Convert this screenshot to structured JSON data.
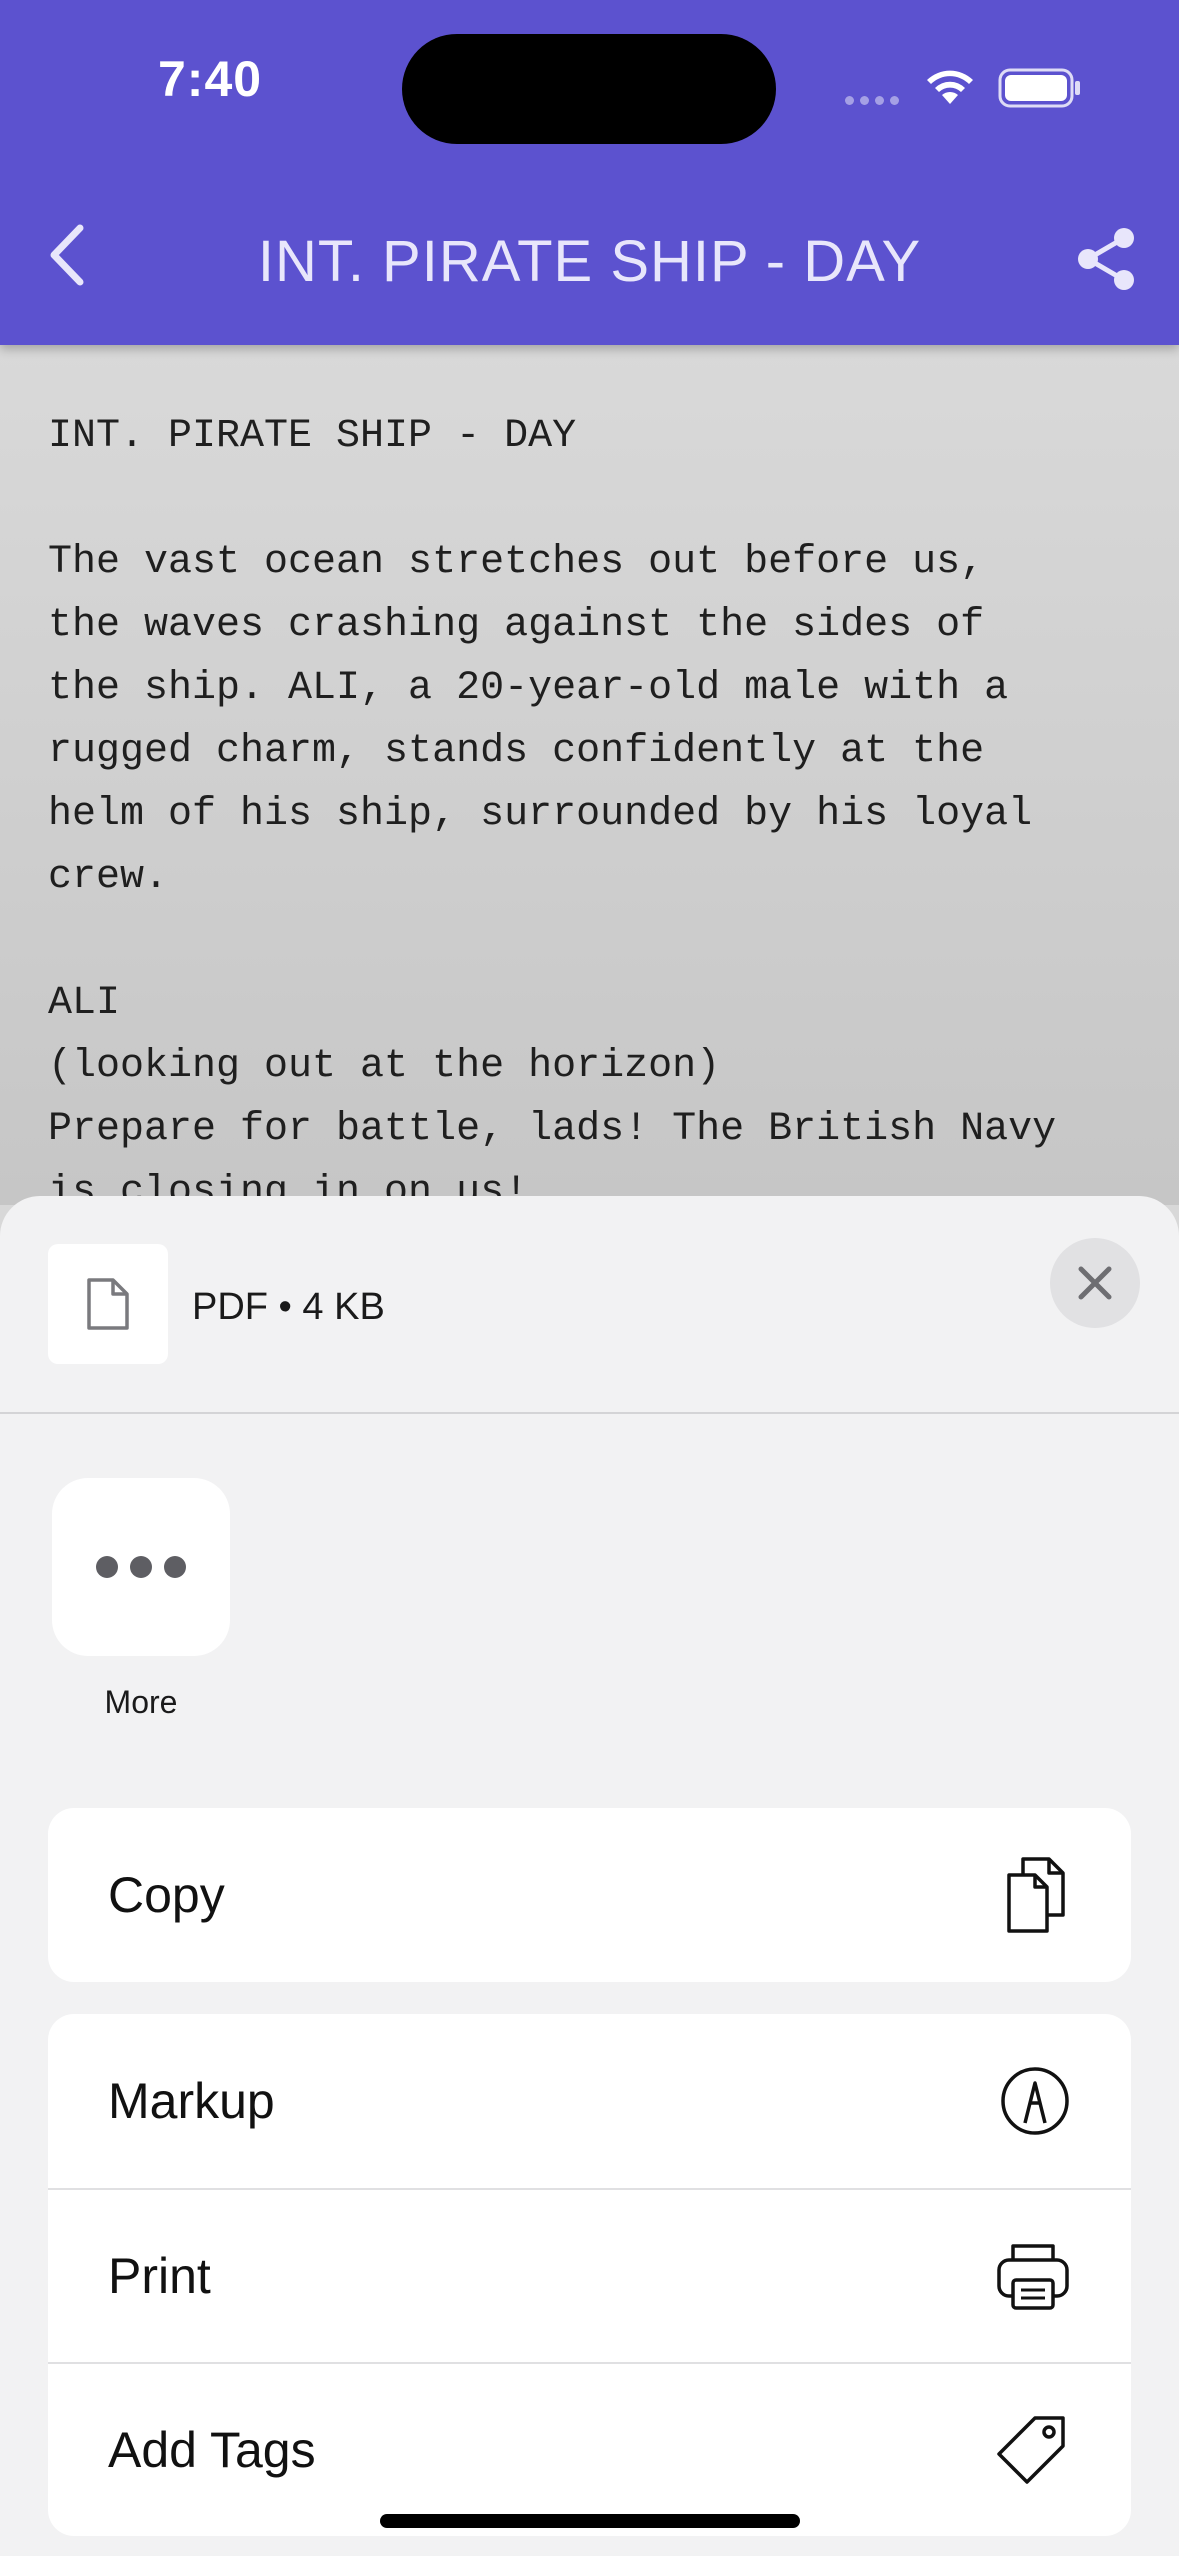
{
  "status_bar": {
    "time": "7:40"
  },
  "nav": {
    "title": "INT. PIRATE SHIP - DAY",
    "back_icon": "chevron-left-icon",
    "share_icon": "share-icon"
  },
  "script": {
    "text": "INT. PIRATE SHIP - DAY\n\nThe vast ocean stretches out before us,\nthe waves crashing against the sides of\nthe ship. ALI, a 20-year-old male with a\nrugged charm, stands confidently at the\nhelm of his ship, surrounded by his loyal\ncrew.\n\nALI\n(looking out at the horizon)\nPrepare for battle, lads! The British Navy\nis closing in on us!"
  },
  "share_sheet": {
    "file_meta": "PDF • 4 KB",
    "more_label": "More",
    "actions_primary": [
      {
        "label": "Copy",
        "icon": "copy-icon"
      }
    ],
    "actions_secondary": [
      {
        "label": "Markup",
        "icon": "markup-icon"
      },
      {
        "label": "Print",
        "icon": "printer-icon"
      },
      {
        "label": "Add Tags",
        "icon": "tag-icon"
      }
    ]
  },
  "colors": {
    "header": "#5c52cf",
    "sheet": "#f2f2f3"
  }
}
